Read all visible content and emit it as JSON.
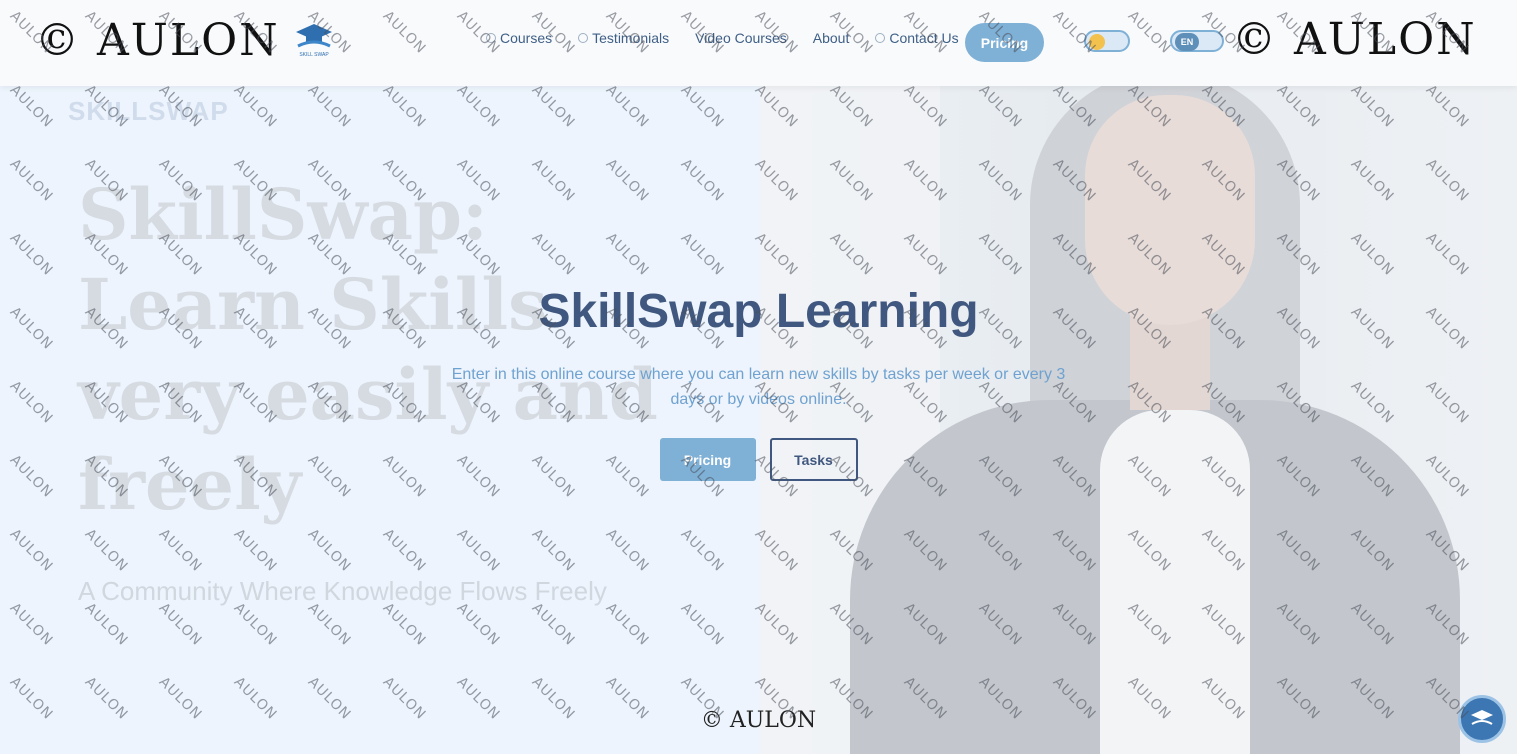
{
  "brand": {
    "name": "© AULON",
    "logo_text": "SKILL SWAP"
  },
  "nav": {
    "links": [
      "Courses",
      "Testimonials",
      "Video Courses",
      "About",
      "Contact Us"
    ],
    "pricing_label": "Pricing",
    "lang_label": "EN"
  },
  "background": {
    "logo_text": "SKILLSWAP",
    "title": "SkillSwap: Learn Skills very easily and freely",
    "tagline": "A Community Where Knowledge Flows Freely"
  },
  "hero": {
    "title": "SkillSwap Learning",
    "subtitle": "Enter in this online course where you can learn new skills by tasks per week or every 3 days or by videos online.",
    "primary_cta": "Pricing",
    "secondary_cta": "Tasks"
  },
  "footer": {
    "mark": "© AULON"
  },
  "watermark": {
    "text": "AULON"
  },
  "colors": {
    "accent": "#7fb0d6",
    "title": "#40587f",
    "subtitle": "#6fa2d0"
  }
}
